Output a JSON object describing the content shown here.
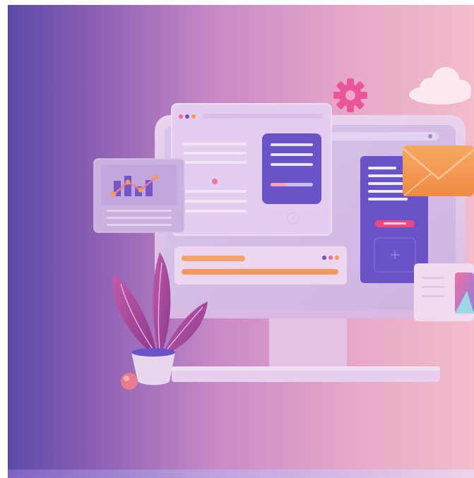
{
  "scene": {
    "subject": "web-development-illustration",
    "colors": {
      "bg_left": "#5a4aa3",
      "bg_mid": "#c98ac7",
      "bg_right": "#f1b5c6",
      "screen_panel": "#dccbed",
      "accent_purple": "#6a52c9",
      "accent_orange": "#f39a5a",
      "accent_pink": "#e8558a",
      "leaf_purple": "#b04fa4"
    },
    "icons": [
      "monitor-icon",
      "gear-icon",
      "cloud-icon",
      "envelope-icon",
      "chart-card-icon",
      "plant-icon",
      "photo-card-icon"
    ]
  }
}
